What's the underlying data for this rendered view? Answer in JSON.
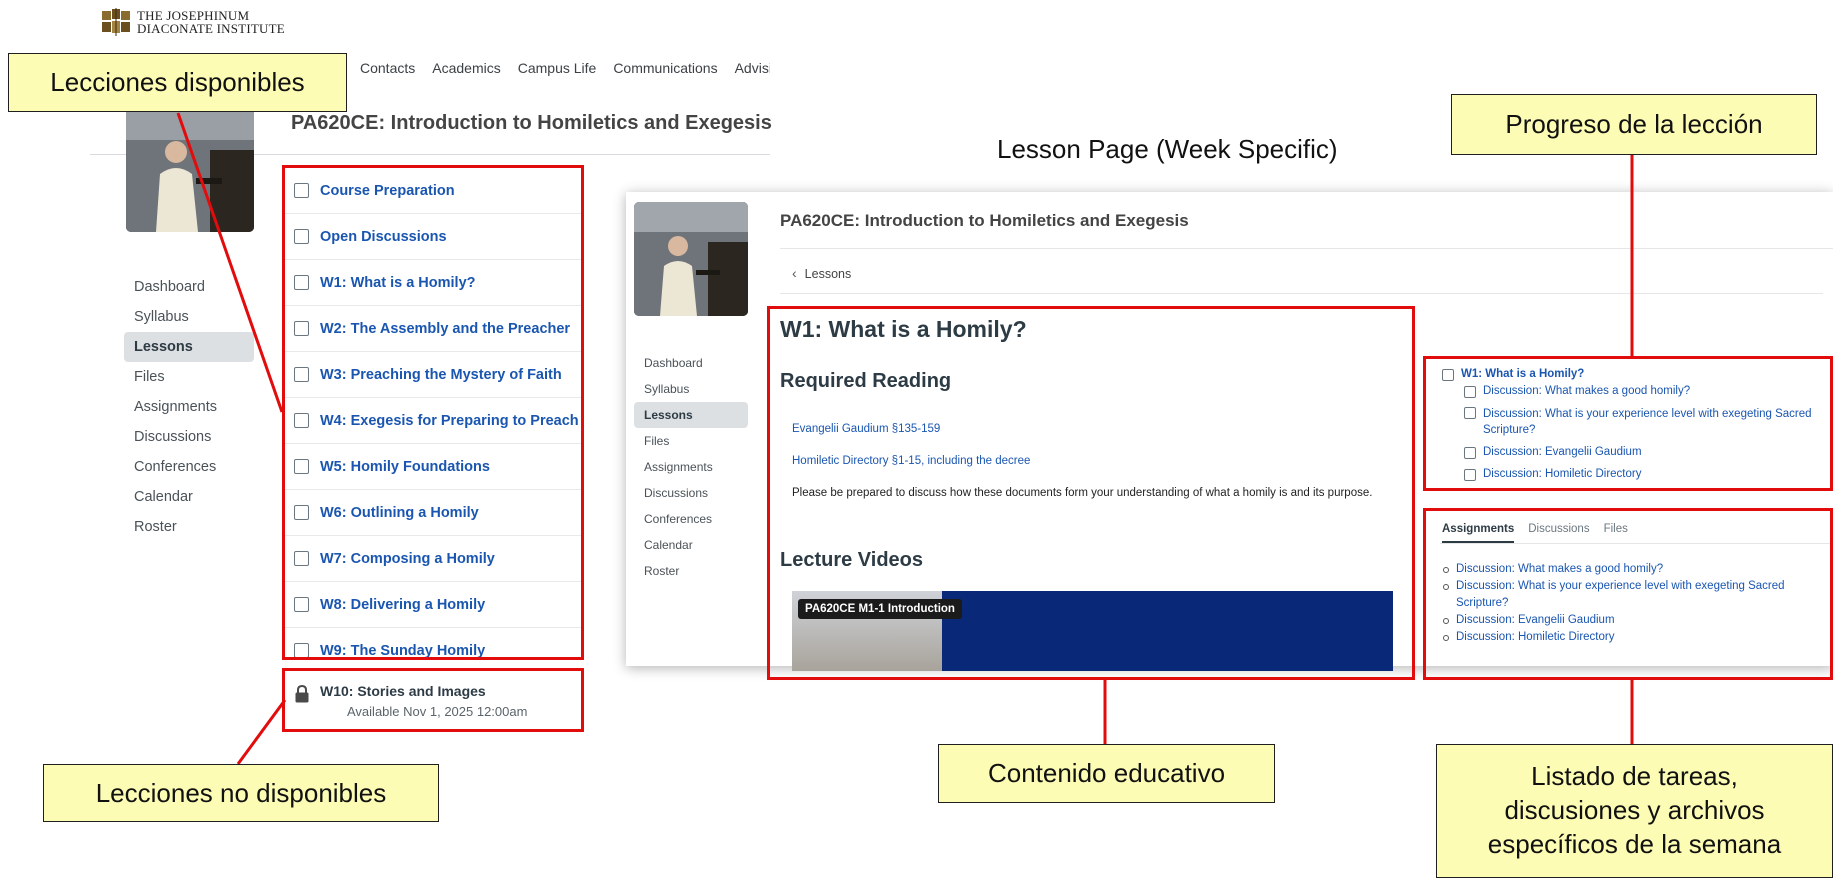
{
  "logo": {
    "line1": "THE JOSEPHINUM",
    "line2": "DIACONATE INSTITUTE"
  },
  "top_nav": {
    "items": [
      "Contacts",
      "Academics",
      "Campus Life",
      "Communications",
      "Advising"
    ]
  },
  "course": {
    "title": "PA620CE: Introduction to Homiletics and Exegesis"
  },
  "left_nav": {
    "items": [
      "Dashboard",
      "Syllabus",
      "Lessons",
      "Files",
      "Assignments",
      "Discussions",
      "Conferences",
      "Calendar",
      "Roster"
    ],
    "active": "Lessons"
  },
  "lessons": {
    "available": [
      "Course Preparation",
      "Open Discussions",
      "W1: What is a Homily?",
      "W2: The Assembly and the Preacher",
      "W3: Preaching the Mystery of Faith",
      "W4: Exegesis for Preparing to Preach",
      "W5: Homily Foundations",
      "W6: Outlining a Homily",
      "W7: Composing a Homily",
      "W8: Delivering a Homily",
      "W9: The Sunday Homily"
    ],
    "locked": {
      "title": "W10: Stories and Images",
      "available_text": "Available Nov 1, 2025 12:00am"
    }
  },
  "lesson_page": {
    "label": "Lesson Page (Week Specific)",
    "breadcrumb": "Lessons",
    "heading": "W1: What is a Homily?",
    "required_reading_heading": "Required Reading",
    "reading_links": [
      "Evangelii Gaudium §135-159",
      "Homiletic Directory §1-15, including the decree"
    ],
    "reading_note": "Please be prepared to discuss how these documents form your understanding of what a homily is and its purpose.",
    "lecture_heading": "Lecture Videos",
    "video_title": "PA620CE M1-1 Introduction"
  },
  "progress": {
    "lesson": "W1: What is a Homily?",
    "items": [
      "Discussion: What makes a good homily?",
      "Discussion: What is your experience level with exegeting Sacred Scripture?",
      "Discussion: Evangelii Gaudium",
      "Discussion: Homiletic Directory"
    ]
  },
  "side_tabs": {
    "tabs": [
      "Assignments",
      "Discussions",
      "Files"
    ],
    "active": "Assignments",
    "items": [
      "Discussion: What makes a good homily?",
      "Discussion: What is your experience level with exegeting Sacred Scripture?",
      "Discussion: Evangelii Gaudium",
      "Discussion: Homiletic Directory"
    ]
  },
  "callouts": {
    "available_lessons": "Lecciones disponibles",
    "unavailable_lessons": "Lecciones no disponibles",
    "lesson_progress": "Progreso de la lección",
    "educational_content": "Contenido educativo",
    "week_list": [
      "Listado de tareas,",
      "discusiones y archivos",
      "específicos de la semana"
    ]
  },
  "colors": {
    "highlight_border": "#e30c0c",
    "callout_fill": "#fdfcb5",
    "link": "#1a56b0",
    "active_nav": "#dde0e3"
  }
}
